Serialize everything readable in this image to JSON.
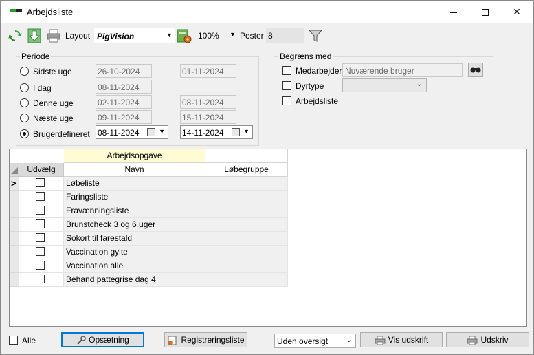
{
  "window": {
    "title": "Arbejdsliste",
    "controls": {
      "minimize": "minimize",
      "maximize": "maximize",
      "close": "✕"
    }
  },
  "toolbar": {
    "layout_label": "Layout",
    "layout_value": "PigVision",
    "zoom_value": "100%",
    "poster_label": "Poster",
    "poster_value": "8"
  },
  "periode": {
    "title": "Periode",
    "options": [
      {
        "label": "Sidste uge",
        "from": "26-10-2024",
        "to": "01-11-2024",
        "selected": false
      },
      {
        "label": "I dag",
        "from": "08-11-2024",
        "to": "",
        "selected": false
      },
      {
        "label": "Denne uge",
        "from": "02-11-2024",
        "to": "08-11-2024",
        "selected": false
      },
      {
        "label": "Næste uge",
        "from": "09-11-2024",
        "to": "15-11-2024",
        "selected": false
      },
      {
        "label": "Brugerdefineret",
        "from": "08-11-2024",
        "to": "14-11-2024",
        "selected": true
      }
    ]
  },
  "begraens": {
    "title": "Begræns med",
    "medarbejder_label": "Medarbejder",
    "medarbejder_value": "Nuværende bruger",
    "dyrtype_label": "Dyrtype",
    "arbejdsliste_label": "Arbejdsliste"
  },
  "grid": {
    "band_header": "Arbejdsopgave",
    "columns": {
      "udvaelg": "Udvælg",
      "navn": "Navn",
      "lobegruppe": "Løbegruppe"
    },
    "current_row_marker": ">",
    "rows": [
      {
        "navn": "Løbeliste",
        "lobegruppe": ""
      },
      {
        "navn": "Faringsliste",
        "lobegruppe": ""
      },
      {
        "navn": "Fravænningsliste",
        "lobegruppe": ""
      },
      {
        "navn": "Brunstcheck 3 og 6 uger",
        "lobegruppe": ""
      },
      {
        "navn": "Sokort til farestald",
        "lobegruppe": ""
      },
      {
        "navn": "Vaccination gylte",
        "lobegruppe": ""
      },
      {
        "navn": "Vaccination alle",
        "lobegruppe": ""
      },
      {
        "navn": "Behand pattegrise dag 4",
        "lobegruppe": ""
      }
    ]
  },
  "bottom": {
    "alle_label": "Alle",
    "opsaetning_label": "Opsætning",
    "registreringsliste_label": "Registreringsliste",
    "oversigt_value": "Uden oversigt",
    "vis_udskrift_label": "Vis udskrift",
    "udskriv_label": "Udskriv"
  },
  "colors": {
    "band_header_bg": "#fffbd2",
    "focus_blue": "#0078d7",
    "app_green": "#2e9b2e"
  }
}
